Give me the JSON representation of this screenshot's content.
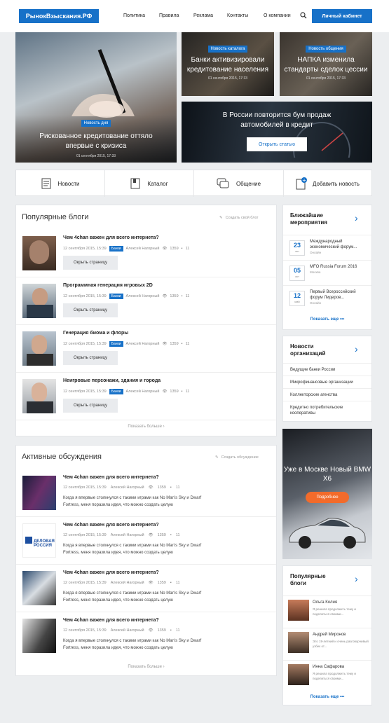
{
  "header": {
    "logo": "РынокВзыскания.РФ",
    "nav": [
      "Политика",
      "Правила",
      "Реклама",
      "Контакты",
      "О компании"
    ],
    "cabinet": "Личный кабинет"
  },
  "hero": {
    "main": {
      "badge": "Новость дня",
      "title": "Рискованное кредитование оттяло впервые с кризиса",
      "date": "01 сентября 2015, 17:33"
    },
    "t1": {
      "badge": "Новость каталога",
      "title": "Банки активизировали кредитование населения",
      "date": "01 сентября 2015, 17:33"
    },
    "t2": {
      "badge": "Новость общения",
      "title": "НАПКА изменила стандарты сделок цессии",
      "date": "01 сентября 2015, 17:33"
    },
    "wide": {
      "title": "В России повторится бум продаж автомобилей в кредит",
      "button": "Открыть статью"
    }
  },
  "categories": [
    "Новости",
    "Каталог",
    "Общение",
    "Добавить новость"
  ],
  "blogs": {
    "heading": "Популярные блоги",
    "create": "Создать свой блог",
    "more": "Показать больше",
    "items": [
      {
        "title": "Чем 4chan важен для всего интернета?",
        "date": "12 сентября 2015, 15:39",
        "tag": "Банки",
        "author": "Алексей Нагорный",
        "views": "1359",
        "comments": "11",
        "button": "Окрыть страницу"
      },
      {
        "title": "Программная генерация игровых 2D",
        "date": "12 сентября 2015, 15:39",
        "tag": "Банки",
        "author": "Алексей Нагорный",
        "views": "1359",
        "comments": "11",
        "button": "Окрыть страницу"
      },
      {
        "title": "Генерация биома и флоры",
        "date": "12 сентября 2015, 15:39",
        "tag": "Банки",
        "author": "Алексей Нагорный",
        "views": "1359",
        "comments": "11",
        "button": "Окрыть страницу"
      },
      {
        "title": "Неигровые персонажи, здания и города",
        "date": "12 сентября 2015, 15:39",
        "tag": "Банки",
        "author": "Алексей Нагорный",
        "views": "1359",
        "comments": "11",
        "button": "Окрыть страницу"
      }
    ]
  },
  "discussions": {
    "heading": "Активные обсуждения",
    "create": "Создать обсуждение",
    "more": "Показать больше",
    "items": [
      {
        "title": "Чем 4chan важен для всего интернета?",
        "date": "12 сентября 2015, 15:39",
        "author": "Алексей Нагорный",
        "views": "1359",
        "comments": "11",
        "excerpt": "Когда я впервые столкнулся с такими играми как No Man's Sky и Dwarf Fortress, меня поразила идея, что можно создать целую"
      },
      {
        "title": "Чем 4chan важен для всего интернета?",
        "date": "12 сентября 2015, 15:39",
        "author": "Алексей Нагорный",
        "views": "1359",
        "comments": "11",
        "excerpt": "Когда я впервые столкнулся с такими играми как No Man's Sky и Dwarf Fortress, меня поразила идея, что можно создать целую"
      },
      {
        "title": "Чем 4chan важен для всего интернета?",
        "date": "12 сентября 2015, 15:39",
        "author": "Алексей Нагорный",
        "views": "1359",
        "comments": "11",
        "excerpt": "Когда я впервые столкнулся с такими играми как No Man's Sky и Dwarf Fortress, меня поразила идея, что можно создать целую"
      },
      {
        "title": "Чем 4chan важен для всего интернета?",
        "date": "12 сентября 2015, 15:39",
        "author": "Алексей Нагорный",
        "views": "1359",
        "comments": "11",
        "excerpt": "Когда я впервые столкнулся с такими играми как No Man's Sky и Dwarf Fortress, меня поразила идея, что можно создать целую"
      }
    ]
  },
  "events": {
    "heading": "Ближайшие мероприятия",
    "more": "Показать еще",
    "items": [
      {
        "day": "23",
        "month": "окт",
        "title": "Международный экономический форум...",
        "place": "Онлайн"
      },
      {
        "day": "05",
        "month": "окт",
        "title": "MFO Russia Forum 2016",
        "place": "Москва"
      },
      {
        "day": "12",
        "month": "май",
        "title": "Первый Всероссийский форум Лидеров...",
        "place": "Онлайн"
      }
    ]
  },
  "orgnews": {
    "heading": "Новости организаций",
    "items": [
      "Ведущие банки России",
      "Микрофинансовые организации",
      "Коллекторские агенства",
      "Кредитно потребительские кооперативы"
    ]
  },
  "ad": {
    "title": "Уже в Москве Новый BMW X6",
    "button": "Подробнее"
  },
  "popblogs": {
    "heading": "Популярные блоги",
    "more": "Показать еще",
    "items": [
      {
        "name": "Ольга Колия",
        "text": "Я решила продолжить тему и поделиться своими..."
      },
      {
        "name": "Андрей Миронов",
        "text": "Это 19-летний и очень разговорчивый узбек от..."
      },
      {
        "name": "Инна Сафарова",
        "text": "Я решила продолжить тему и поделиться своими..."
      }
    ]
  },
  "partner_logo": "ДЕЛОВАЯ РОССИЯ"
}
